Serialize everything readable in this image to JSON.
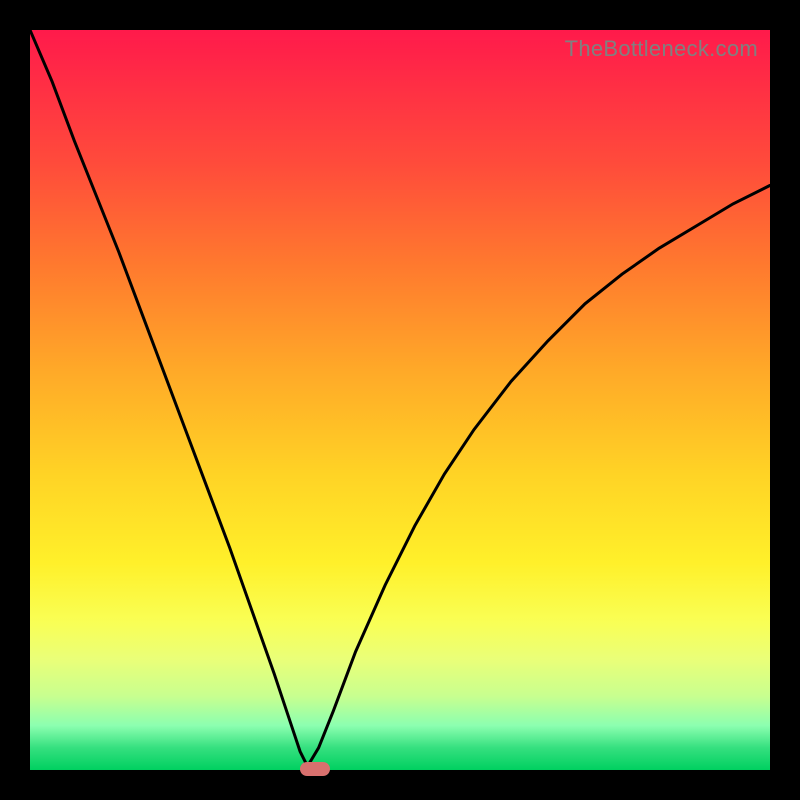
{
  "watermark": "TheBottleneck.com",
  "colors": {
    "frame_bg": "#000000",
    "gradient_top": "#ff1a4b",
    "gradient_bottom": "#00d060",
    "curve": "#000000",
    "marker": "#d8706e",
    "watermark": "#808080"
  },
  "chart_data": {
    "type": "line",
    "title": "",
    "xlabel": "",
    "ylabel": "",
    "xlim": [
      0,
      100
    ],
    "ylim": [
      0,
      100
    ],
    "note": "Values read from pixel positions; y=0 bottom. Two branches meeting at a minimum near x≈37.",
    "series": [
      {
        "name": "left-branch",
        "x": [
          0.0,
          3.0,
          6.0,
          9.0,
          12.0,
          15.0,
          18.0,
          21.0,
          24.0,
          27.0,
          30.0,
          33.0,
          35.0,
          36.5,
          37.5
        ],
        "values": [
          100.0,
          93.0,
          85.0,
          77.5,
          70.0,
          62.0,
          54.0,
          46.0,
          38.0,
          30.0,
          21.5,
          13.0,
          7.0,
          2.5,
          0.5
        ]
      },
      {
        "name": "right-branch",
        "x": [
          37.5,
          39.0,
          41.0,
          44.0,
          48.0,
          52.0,
          56.0,
          60.0,
          65.0,
          70.0,
          75.0,
          80.0,
          85.0,
          90.0,
          95.0,
          100.0
        ],
        "values": [
          0.5,
          3.0,
          8.0,
          16.0,
          25.0,
          33.0,
          40.0,
          46.0,
          52.5,
          58.0,
          63.0,
          67.0,
          70.5,
          73.5,
          76.5,
          79.0
        ]
      }
    ],
    "marker": {
      "x_center": 38.5,
      "width_pct": 4.0,
      "y": 0.0
    }
  }
}
